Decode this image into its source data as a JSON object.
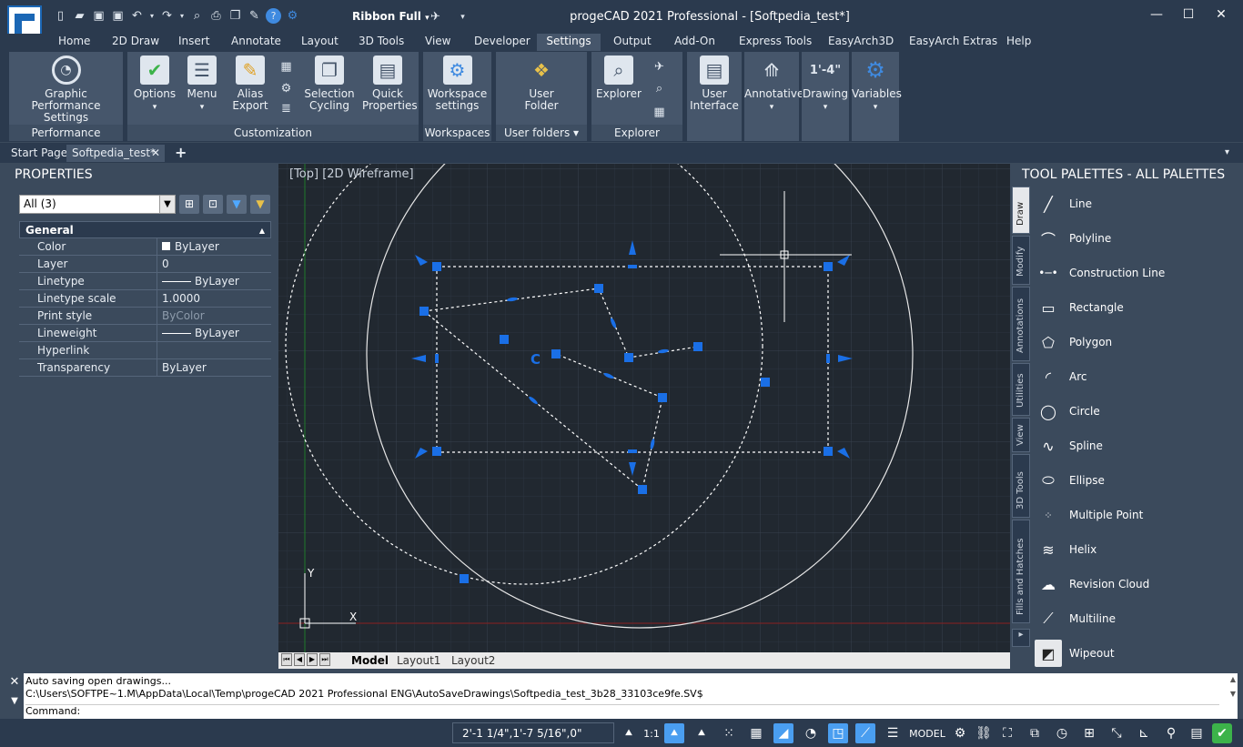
{
  "app": {
    "title": "progeCAD 2021 Professional - [Softpedia_test*]",
    "workspace": "Ribbon Full"
  },
  "qat_icons": [
    "new-icon",
    "open-icon",
    "save-icon",
    "saveas-icon",
    "undo-icon",
    "redo-icon",
    "preview-icon",
    "print-icon",
    "copy-icon",
    "paintbrush-icon",
    "help-icon",
    "gear-icon"
  ],
  "ribbon_tabs": [
    "Home",
    "2D Draw",
    "Insert",
    "Annotate",
    "Layout",
    "3D Tools",
    "View",
    "Developer",
    "Settings",
    "Output",
    "Add-On",
    "Express Tools",
    "EasyArch3D",
    "EasyArch Extras",
    "Help"
  ],
  "active_tab": "Settings",
  "ribbon": {
    "performance": {
      "title": "Performance",
      "btn": "Graphic Performance Settings"
    },
    "customization": {
      "title": "Customization",
      "options": "Options",
      "menu": "Menu",
      "alias": "Alias Export",
      "selcycle": "Selection Cycling",
      "quickprops": "Quick Properties"
    },
    "workspaces": {
      "title": "Workspaces",
      "btn": "Workspace settings"
    },
    "userfolders": {
      "title": "User folders",
      "btn": "User Folder"
    },
    "explorer": {
      "title": "Explorer",
      "btn": "Explorer"
    },
    "userif": {
      "btn": "User Interface"
    },
    "annotative": {
      "btn": "Annotative"
    },
    "drawing": {
      "btn": "Drawing",
      "icon_text": "1'-4\""
    },
    "variables": {
      "btn": "Variables"
    }
  },
  "doc_tabs": {
    "start": "Start Page",
    "current": "Softpedia_test*"
  },
  "properties": {
    "title": "PROPERTIES",
    "selection": "All (3)",
    "group": "General",
    "rows": [
      {
        "k": "Color",
        "v": "ByLayer"
      },
      {
        "k": "Layer",
        "v": "0"
      },
      {
        "k": "Linetype",
        "v": "ByLayer"
      },
      {
        "k": "Linetype scale",
        "v": "1.0000"
      },
      {
        "k": "Print style",
        "v": "ByColor"
      },
      {
        "k": "Lineweight",
        "v": "ByLayer"
      },
      {
        "k": "Hyperlink",
        "v": ""
      },
      {
        "k": "Transparency",
        "v": "ByLayer"
      }
    ]
  },
  "canvas": {
    "view_label": "[Top] [2D Wireframe]",
    "axis_y": "Y",
    "axis_x": "X",
    "center_mark": "C"
  },
  "layout_tabs": [
    "Model",
    "Layout1",
    "Layout2"
  ],
  "tool_palettes": {
    "title": "TOOL PALETTES - ALL PALETTES",
    "vtabs": [
      "Draw",
      "Modify",
      "Annotations",
      "Utilities",
      "View",
      "3D Tools",
      "Fills and Hatches"
    ],
    "items": [
      "Line",
      "Polyline",
      "Construction Line",
      "Rectangle",
      "Polygon",
      "Arc",
      "Circle",
      "Spline",
      "Ellipse",
      "Multiple Point",
      "Helix",
      "Revision Cloud",
      "Multiline",
      "Wipeout"
    ]
  },
  "command": {
    "line1": "Auto saving open drawings...",
    "line2": "C:\\Users\\SOFTPE~1.M\\AppData\\Local\\Temp\\progeCAD 2021 Professional ENG\\AutoSaveDrawings\\Softpedia_test_3b28_33103ce9fe.SV$",
    "prompt": "Command:"
  },
  "status": {
    "coords": "2'-1 1/4\",1'-7 5/16\",0\"",
    "scale": "1:1",
    "space": "MODEL"
  },
  "colors": {
    "accent": "#4a9ef0",
    "grip": "#1a6fe6",
    "bg": "#2b3a4e",
    "canvas": "#212830"
  }
}
